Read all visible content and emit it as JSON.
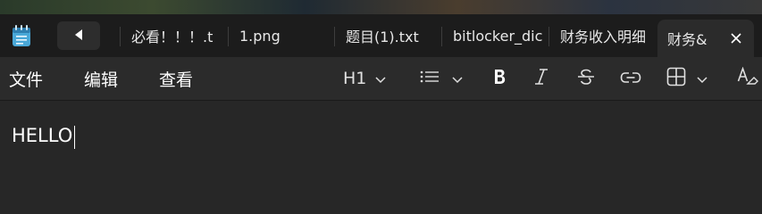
{
  "tabs": [
    {
      "label": "必看！！！.t"
    },
    {
      "label": "1.png"
    },
    {
      "label": "题目(1).txt"
    },
    {
      "label": "bitlocker_dic"
    },
    {
      "label": "财务收入明细"
    },
    {
      "label": "财务&"
    }
  ],
  "menu": {
    "file": "文件",
    "edit": "编辑",
    "view": "查看"
  },
  "toolbar": {
    "heading": "H1"
  },
  "editor": {
    "content": "HELLO"
  }
}
